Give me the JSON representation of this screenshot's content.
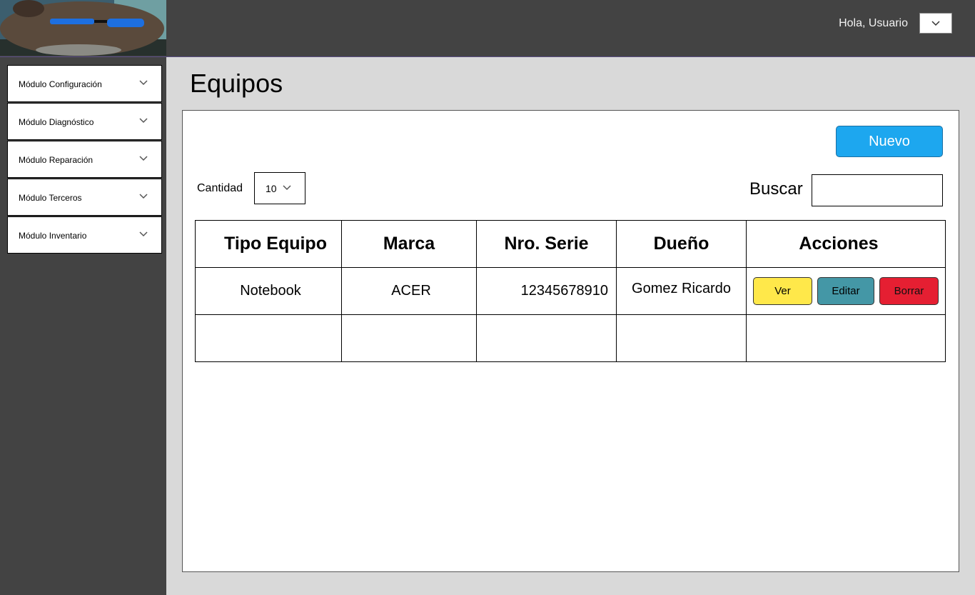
{
  "header": {
    "greeting": "Hola, Usuario",
    "user_menu_icon": "chevron-down-icon"
  },
  "sidebar": {
    "items": [
      {
        "label": "Módulo Configuración",
        "icon": "chevron-down-icon"
      },
      {
        "label": "Módulo Diagnóstico",
        "icon": "chevron-down-icon"
      },
      {
        "label": "Módulo Reparación",
        "icon": "chevron-down-icon"
      },
      {
        "label": "Módulo Terceros",
        "icon": "chevron-down-icon"
      },
      {
        "label": "Módulo Inventario",
        "icon": "chevron-down-icon"
      }
    ]
  },
  "main": {
    "title": "Equipos",
    "new_button": "Nuevo",
    "quantity_label": "Cantidad",
    "quantity_value": "10",
    "search_label": "Buscar",
    "search_value": ""
  },
  "table": {
    "columns": [
      "Tipo Equipo",
      "Marca",
      "Nro. Serie",
      "Dueño",
      "Acciones"
    ],
    "rows": [
      {
        "tipo": "Notebook",
        "marca": "ACER",
        "serie": "12345678910",
        "dueno": "Gomez Ricardo",
        "actions": {
          "ver": "Ver",
          "editar": "Editar",
          "borrar": "Borrar"
        }
      }
    ]
  },
  "colors": {
    "topbar": "#434343",
    "sidebar": "#434343",
    "background": "#d9d9d9",
    "nuevo_button": "#1da7ef",
    "ver_button": "#ffe84a",
    "editar_button": "#4497a6",
    "borrar_button": "#e51f32"
  }
}
